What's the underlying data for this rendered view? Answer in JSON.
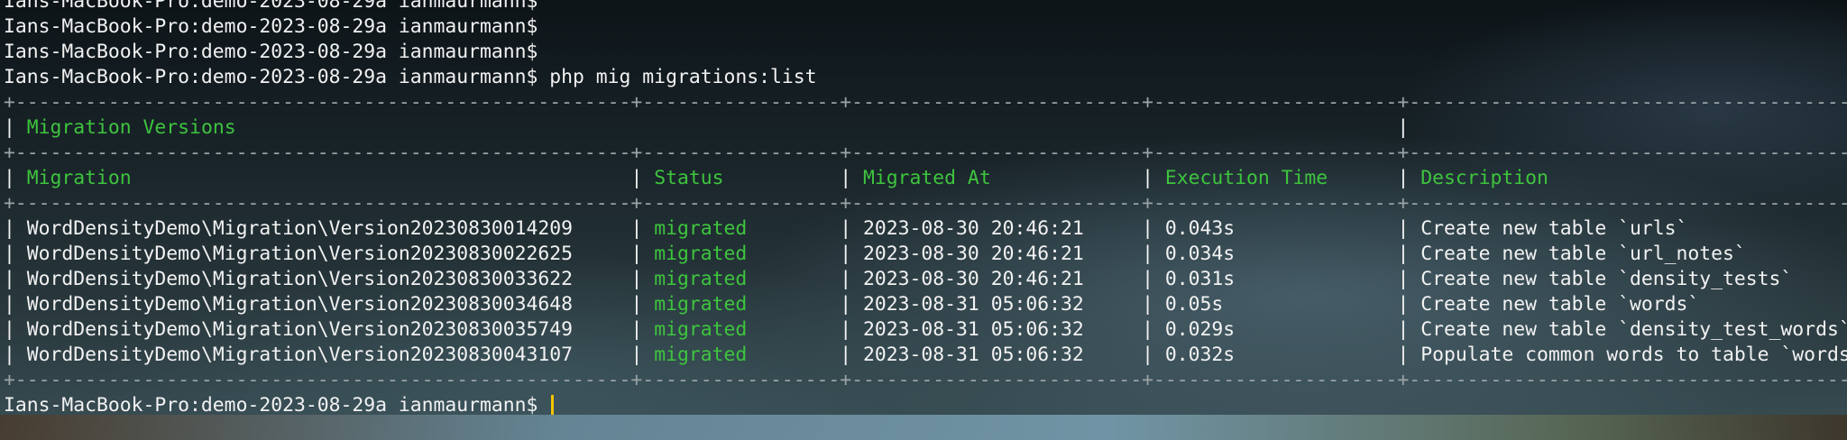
{
  "prompt": "Ians-MacBook-Pro:demo-2023-08-29a ianmaurmann$",
  "command": "php mig migrations:list",
  "table": {
    "title": "Migration Versions",
    "headers": [
      "Migration",
      "Status",
      "Migrated At",
      "Execution Time",
      "Description"
    ],
    "rows": [
      [
        "WordDensityDemo\\Migration\\Version20230830014209",
        "migrated",
        "2023-08-30 20:46:21",
        "0.043s",
        "Create new table `urls`"
      ],
      [
        "WordDensityDemo\\Migration\\Version20230830022625",
        "migrated",
        "2023-08-30 20:46:21",
        "0.034s",
        "Create new table `url_notes`"
      ],
      [
        "WordDensityDemo\\Migration\\Version20230830033622",
        "migrated",
        "2023-08-30 20:46:21",
        "0.031s",
        "Create new table `density_tests`"
      ],
      [
        "WordDensityDemo\\Migration\\Version20230830034648",
        "migrated",
        "2023-08-31 05:06:32",
        "0.05s",
        "Create new table `words`"
      ],
      [
        "WordDensityDemo\\Migration\\Version20230830035749",
        "migrated",
        "2023-08-31 05:06:32",
        "0.029s",
        "Create new table `density_test_words`"
      ],
      [
        "WordDensityDemo\\Migration\\Version20230830043107",
        "migrated",
        "2023-08-31 05:06:32",
        "0.032s",
        "Populate common words to table `words`"
      ]
    ]
  },
  "colors": {
    "text": "#f2f2f2",
    "accent_green": "#3ec43e",
    "cursor": "#f5c400"
  }
}
